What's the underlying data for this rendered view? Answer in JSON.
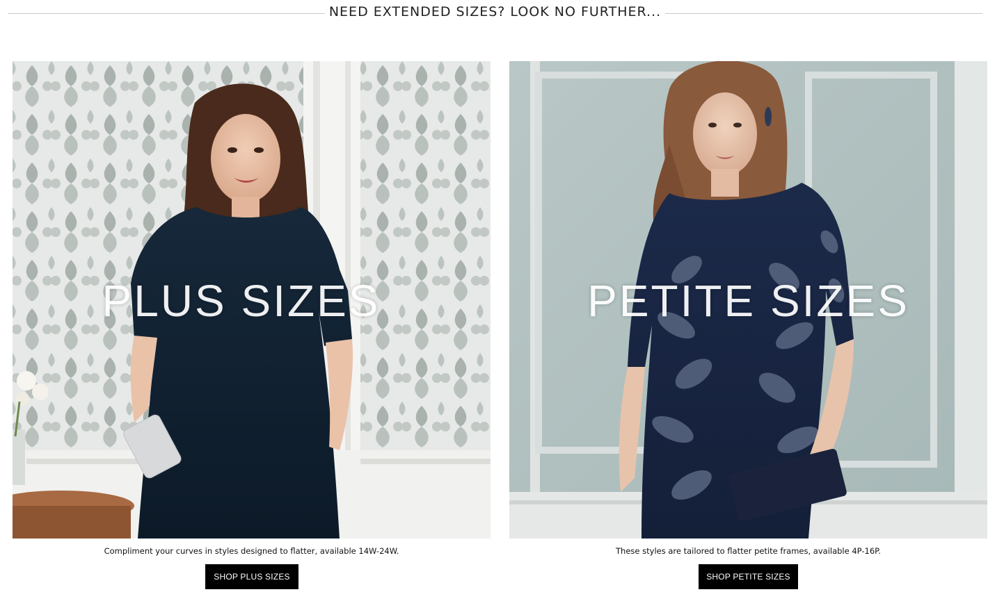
{
  "section": {
    "heading": "NEED EXTENDED SIZES? LOOK NO FURTHER..."
  },
  "cards": [
    {
      "title": "PLUS SIZES",
      "description": "Compliment your curves in styles designed to flatter, available 14W-24W.",
      "button_label": "SHOP PLUS SIZES",
      "image_alt": "Woman in a dark navy sparkle dress holding a silver clutch against damask wallpaper"
    },
    {
      "title": "PETITE SIZES",
      "description": "These styles are tailored to flatter petite frames, available 4P-16P.",
      "button_label": "SHOP PETITE SIZES",
      "image_alt": "Woman in a navy lace overlay dress holding a navy clutch against a pale blue panelled wall"
    }
  ],
  "colors": {
    "button_bg": "#000000",
    "button_text": "#ffffff",
    "divider": "#c9c9c9"
  }
}
